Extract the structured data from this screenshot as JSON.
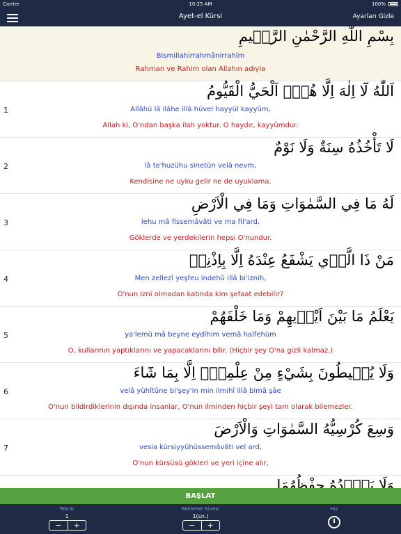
{
  "status": {
    "carrier": "Carrier",
    "time": "10:25 AM",
    "battery": "100%"
  },
  "nav": {
    "title": "Ayet-el Kürsi",
    "hide_settings": "Ayarları Gizle"
  },
  "verses": [
    {
      "num": "",
      "arabic": "بِسْمِ اللّٰهِ الرَّحْمٰنِ الرَّح۪يمِ",
      "translit": "Bismillahirrahmânirrahîm",
      "meaning": "Rahman ve Rahim olan Allahın adıyla"
    },
    {
      "num": "1",
      "arabic": "اَللّٰهُ لَٓا اِلٰهَ اِلَّا هُوَۚ اَلْحَيُّ الْقَيُّومُ",
      "translit": "Allâhü lâ ilâhe illâ hüvel hayyül kayyûm,",
      "meaning": "Allah ki, O'ndan başka ilah yoktur. O haydır, kayyûmdur."
    },
    {
      "num": "2",
      "arabic": "لَا تَأْخُذُهُ سِنَةٌ وَلَا نَوْمٌ",
      "translit": "lâ te'huzühu sinetün velâ nevm,",
      "meaning": "Kendisine ne uyku gelir ne de uyuklama."
    },
    {
      "num": "3",
      "arabic": "لَهُ مَا فِي السَّمٰوَاتِ وَمَا فِي الْاَرْضِ",
      "translit": "lehu mâ fissemâvâti ve ma fil'ard.",
      "meaning": "Göklerde ve yerdekilerin hepsi O'nundur."
    },
    {
      "num": "4",
      "arabic": "مَنْ ذَا الَّذ۪ي يَشْفَعُ عِنْدَهُ اِلَّا بِاِذْنِه۪",
      "translit": "Men zellezî yeşfeu indehû illâ bi'iznih,",
      "meaning": "O'nun izni olmadan katında kim şefaat edebilir?"
    },
    {
      "num": "5",
      "arabic": "يَعْلَمُ مَا بَيْنَ اَيْد۪يهِمْ وَمَا خَلْفَهُمْ",
      "translit": "ya'lemü mâ beyne eydîhim vemâ halfehüm",
      "meaning": "O, kullarının yaptıklarını ve yapacaklarını bilir. (Hiçbir şey O'na gizli kalmaz.)"
    },
    {
      "num": "6",
      "arabic": "وَلَا يُح۪يطُونَ بِشَيْءٍ مِنْ عِلْمِه۪ٓ اِلَّا بِمَا شَٓاءَ",
      "translit": "velâ yühîtûne bi'şey'in min ilmihî illâ bimâ şâe",
      "meaning": "O'nun bildirdiklerinin dışında insanlar, O'nun ilminden hiçbir şeyi tam olarak bilemezler."
    },
    {
      "num": "7",
      "arabic": "وَسِعَ كُرْسِيُّهُ السَّمٰوَاتِ وَالْاَرْضَ",
      "translit": "vesia kürsiyyühüssemâvâti vel ard,",
      "meaning": "O'nun kürsüsü gökleri ve yeri içine alır,"
    },
    {
      "num": "",
      "arabic": "وَلَا يَؤُ۫دُهُ حِفْظُهُمَا",
      "translit": "",
      "meaning": ""
    }
  ],
  "start_button": "BAŞLAT",
  "settings": {
    "repeat_label": "Tekrar",
    "repeat_value": "1",
    "wait_label": "Bekleme Süresi",
    "wait_value": "1(sn.)",
    "speed_label": "Hız",
    "minus": "−",
    "plus": "+"
  },
  "colors": {
    "navbar": "#1f2a44",
    "start": "#56a241",
    "translit": "#2a49c8",
    "meaning": "#c01c1c",
    "basmala_bg": "#f8f5e6"
  }
}
